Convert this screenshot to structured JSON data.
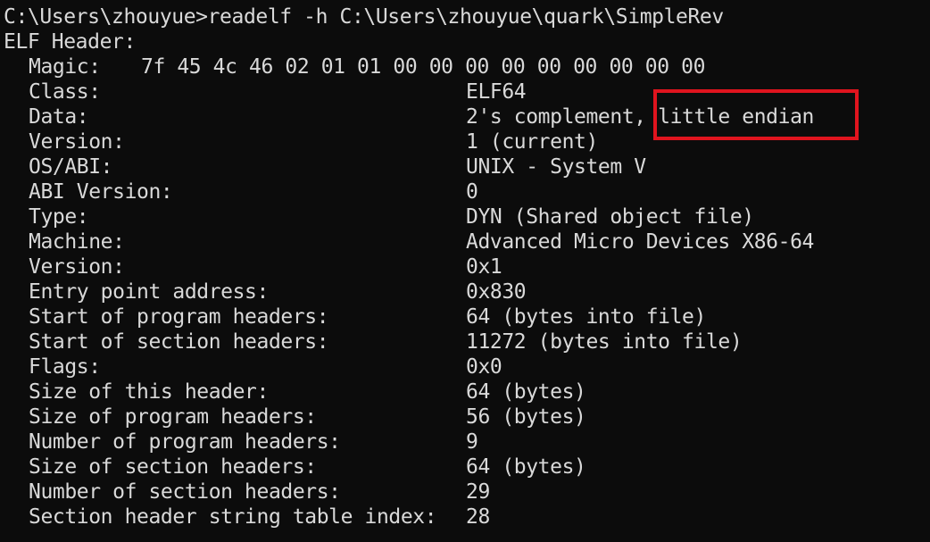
{
  "prompt_line": "C:\\Users\\zhouyue>readelf -h C:\\Users\\zhouyue\\quark\\SimpleRev",
  "header_title": "ELF Header:",
  "magic": {
    "label": "Magic:",
    "value": "7f 45 4c 46 02 01 01 00 00 00 00 00 00 00 00 00"
  },
  "fields": [
    {
      "label": "Class:",
      "value": "ELF64"
    },
    {
      "label": "Data:",
      "value": "2's complement, little endian"
    },
    {
      "label": "Version:",
      "value": "1 (current)"
    },
    {
      "label": "OS/ABI:",
      "value": "UNIX - System V"
    },
    {
      "label": "ABI Version:",
      "value": "0"
    },
    {
      "label": "Type:",
      "value": "DYN (Shared object file)"
    },
    {
      "label": "Machine:",
      "value": "Advanced Micro Devices X86-64"
    },
    {
      "label": "Version:",
      "value": "0x1"
    },
    {
      "label": "Entry point address:",
      "value": "0x830"
    },
    {
      "label": "Start of program headers:",
      "value": "64 (bytes into file)"
    },
    {
      "label": "Start of section headers:",
      "value": "11272 (bytes into file)"
    },
    {
      "label": "Flags:",
      "value": "0x0"
    },
    {
      "label": "Size of this header:",
      "value": "64 (bytes)"
    },
    {
      "label": "Size of program headers:",
      "value": "56 (bytes)"
    },
    {
      "label": "Number of program headers:",
      "value": "9"
    },
    {
      "label": "Size of section headers:",
      "value": "64 (bytes)"
    },
    {
      "label": "Number of section headers:",
      "value": "29"
    },
    {
      "label": "Section header string table index:",
      "value": "28"
    }
  ],
  "colors": {
    "background": "#0c0c0c",
    "text": "#d9d9d9",
    "highlight_border": "#e0141e"
  }
}
